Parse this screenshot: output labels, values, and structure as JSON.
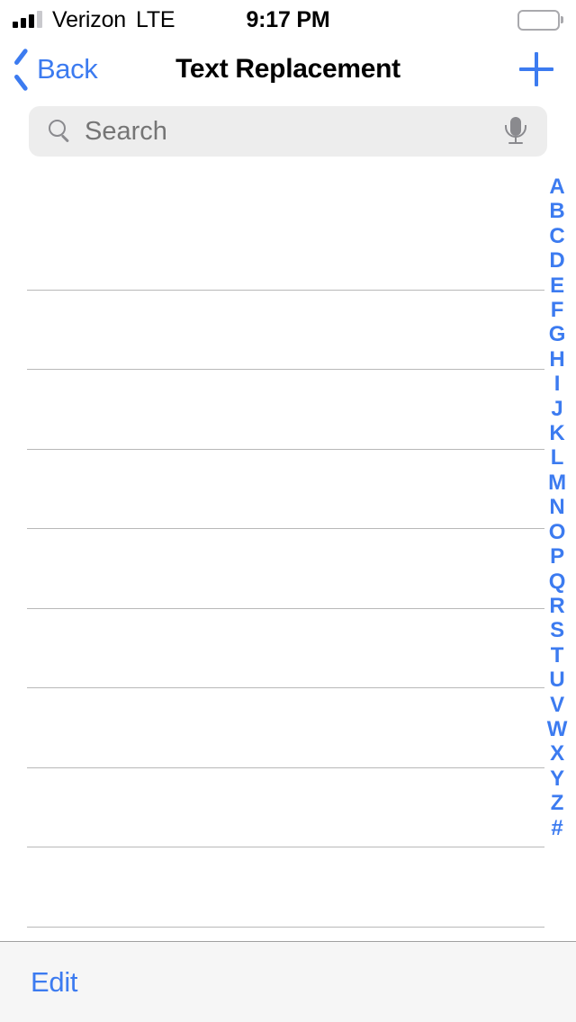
{
  "status_bar": {
    "carrier": "Verizon",
    "network_type": "LTE",
    "time": "9:17 PM",
    "signal_bars_filled": 3,
    "signal_bars_total": 4,
    "battery_level": "100"
  },
  "nav_bar": {
    "back_label": "Back",
    "title": "Text Replacement",
    "add_label": "+"
  },
  "search": {
    "placeholder": "Search",
    "value": ""
  },
  "table": {
    "rows": [
      {
        "shortcut": "",
        "phrase": ""
      },
      {
        "shortcut": "",
        "phrase": ""
      },
      {
        "shortcut": "",
        "phrase": ""
      },
      {
        "shortcut": "",
        "phrase": ""
      },
      {
        "shortcut": "",
        "phrase": ""
      },
      {
        "shortcut": "",
        "phrase": ""
      },
      {
        "shortcut": "",
        "phrase": ""
      },
      {
        "shortcut": "",
        "phrase": ""
      },
      {
        "shortcut": "",
        "phrase": ""
      }
    ]
  },
  "section_index": [
    "A",
    "B",
    "C",
    "D",
    "E",
    "F",
    "G",
    "H",
    "I",
    "J",
    "K",
    "L",
    "M",
    "N",
    "O",
    "P",
    "Q",
    "R",
    "S",
    "T",
    "U",
    "V",
    "W",
    "X",
    "Y",
    "Z",
    "#"
  ],
  "toolbar": {
    "edit_label": "Edit"
  },
  "colors": {
    "accent_blue": "#3c7bf0",
    "search_field_bg": "#ededed",
    "placeholder_gray": "#8a8a8e",
    "separator_gray": "#b8b8b8",
    "toolbar_bg": "#f6f6f6",
    "page_bg": "#ffffff"
  }
}
